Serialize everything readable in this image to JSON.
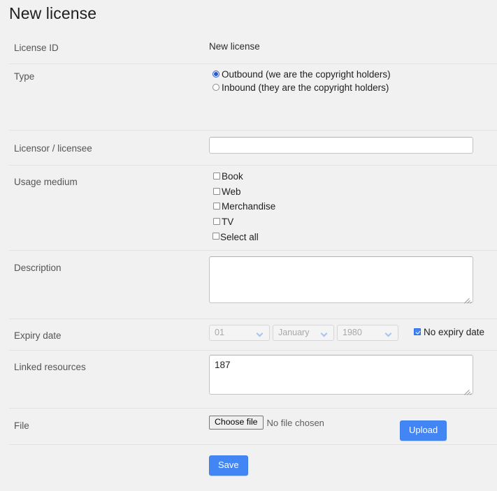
{
  "page": {
    "title": "New license"
  },
  "rows": {
    "license_id": {
      "label": "License ID",
      "value": "New license"
    },
    "type": {
      "label": "Type",
      "options": [
        {
          "label": "Outbound (we are the copyright holders)",
          "checked": true
        },
        {
          "label": "Inbound (they are the copyright holders)",
          "checked": false
        }
      ]
    },
    "licensor": {
      "label": "Licensor / licensee",
      "value": "",
      "placeholder": ""
    },
    "usage_medium": {
      "label": "Usage medium",
      "options": [
        {
          "label": "Book",
          "checked": false
        },
        {
          "label": "Web",
          "checked": false
        },
        {
          "label": "Merchandise",
          "checked": false
        },
        {
          "label": "TV",
          "checked": false
        },
        {
          "label": "Select all",
          "checked": false
        }
      ]
    },
    "description": {
      "label": "Description",
      "value": "",
      "placeholder": ""
    },
    "expiry_date": {
      "label": "Expiry date",
      "day": "01",
      "month": "January",
      "year": "1980",
      "disabled": true,
      "no_expiry_label": "No expiry date",
      "no_expiry_checked": true
    },
    "linked_resources": {
      "label": "Linked resources",
      "value": "187",
      "placeholder": ""
    },
    "file": {
      "label": "File",
      "choose_label": "Choose file",
      "status": "No file chosen",
      "upload_label": "Upload"
    },
    "save": {
      "label": "Save"
    }
  },
  "colors": {
    "accent": "#4285f4",
    "radio_selected": "#2a56d6",
    "background": "#f1f1f1",
    "divider": "#e2e2e2",
    "label_text": "#555555"
  }
}
